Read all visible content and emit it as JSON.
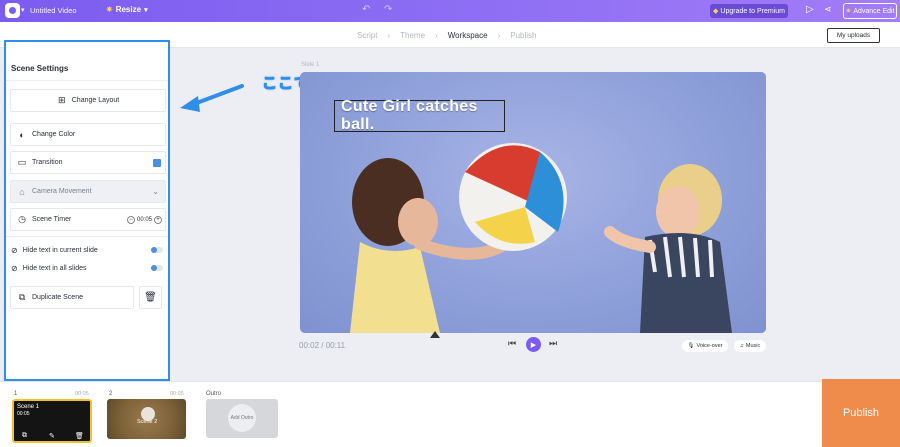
{
  "topbar": {
    "title": "Untitled Video",
    "resize_label": "Resize",
    "upgrade_label": "Upgrade to Premium",
    "advance_label": "Advance Edit"
  },
  "nav": {
    "steps": [
      "Script",
      "Theme",
      "Workspace",
      "Publish"
    ],
    "active_step": "Workspace",
    "my_uploads": "My uploads"
  },
  "panel": {
    "title": "Scene Settings",
    "change_layout": "Change Layout",
    "change_color": "Change Color",
    "transition": "Transition",
    "camera_movement": "Camera Movement",
    "scene_timer": "Scene Timer",
    "timer_value": "00:05",
    "hide_current": "Hide text in current slide",
    "hide_all": "Hide text in all slides",
    "duplicate": "Duplicate Scene"
  },
  "annotation": {
    "text": "ここで微調整",
    "color": "#2e8ee8"
  },
  "canvas": {
    "slide_label": "Slide 1",
    "caption": "Cute Girl catches ball."
  },
  "player": {
    "time": "00:02 / 00:11",
    "voiceover": "Voice-over",
    "music": "Music"
  },
  "scenes": [
    {
      "num": "1",
      "dur": "00:05",
      "label": "Scene 1",
      "sublabel": "00:05"
    },
    {
      "num": "2",
      "dur": "00:05",
      "label": "Scene 2"
    },
    {
      "num": "Outro",
      "add_label": "Add Outro"
    }
  ],
  "publish_label": "Publish",
  "colors": {
    "brand": "#7b5cf0",
    "accent_blue": "#2e8ee8",
    "publish": "#ef8c4c"
  }
}
